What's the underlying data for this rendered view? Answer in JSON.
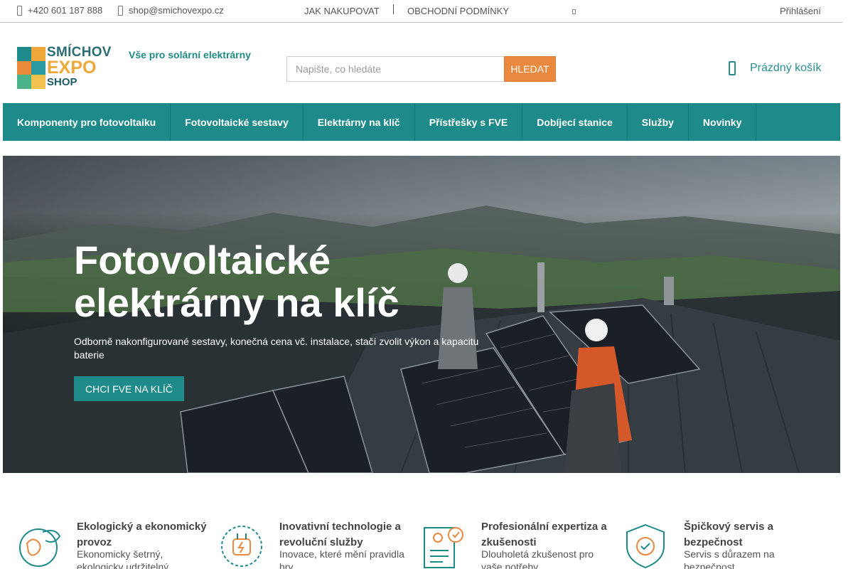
{
  "topbar": {
    "phone": "+420 601 187 888",
    "email": "shop@smichovexpo.cz",
    "links": [
      "JAK NAKUPOVAT",
      "OBCHODNÍ PODMÍNKY"
    ],
    "login": "Přihlášení"
  },
  "header": {
    "logo": {
      "line1": "SMÍCHOV",
      "line2": "EXPO",
      "line3": "SHOP"
    },
    "tagline": "Vše pro solární elektrárny",
    "search": {
      "placeholder": "Napište, co hledáte",
      "button": "HLEDAT"
    },
    "cart": {
      "label": "Prázdný košík",
      "icon": "cart-icon"
    }
  },
  "nav": {
    "items": [
      "Komponenty pro fotovoltaiku",
      "Fotovoltaické sestavy",
      "Elektrárny na klíč",
      "Přístřešky s FVE",
      "Dobíjecí stanice",
      "Služby",
      "Novinky"
    ]
  },
  "hero": {
    "title": "Fotovoltaické elektrárny na klíč",
    "subtitle": "Odborně nakonfigurované sestavy, konečná cena vč. instalace, stačí zvolit výkon a kapacitu baterie",
    "cta": "CHCI FVE NA KLÍČ"
  },
  "features": [
    {
      "icon": "eco-globe-icon",
      "title": "Ekologický a ekonomický provoz",
      "text": "Ekonomicky šetrný, ekologicky udržitelný"
    },
    {
      "icon": "plug-innovation-icon",
      "title": "Inovativní technologie a revoluční služby",
      "text": "Inovace, které mění pravidla hry"
    },
    {
      "icon": "certificate-expert-icon",
      "title": "Profesionální expertiza a zkušenosti",
      "text": "Dlouholetá zkušenost pro vaše potřeby"
    },
    {
      "icon": "shield-check-icon",
      "title": "Špičkový servis a bezpečnost",
      "text": "Servis s důrazem na bezpečnost"
    }
  ],
  "colors": {
    "primary": "#1e8a8a",
    "accent": "#e8893f",
    "logo_teal": "#2b6d74",
    "logo_orange": "#f0a73a"
  }
}
